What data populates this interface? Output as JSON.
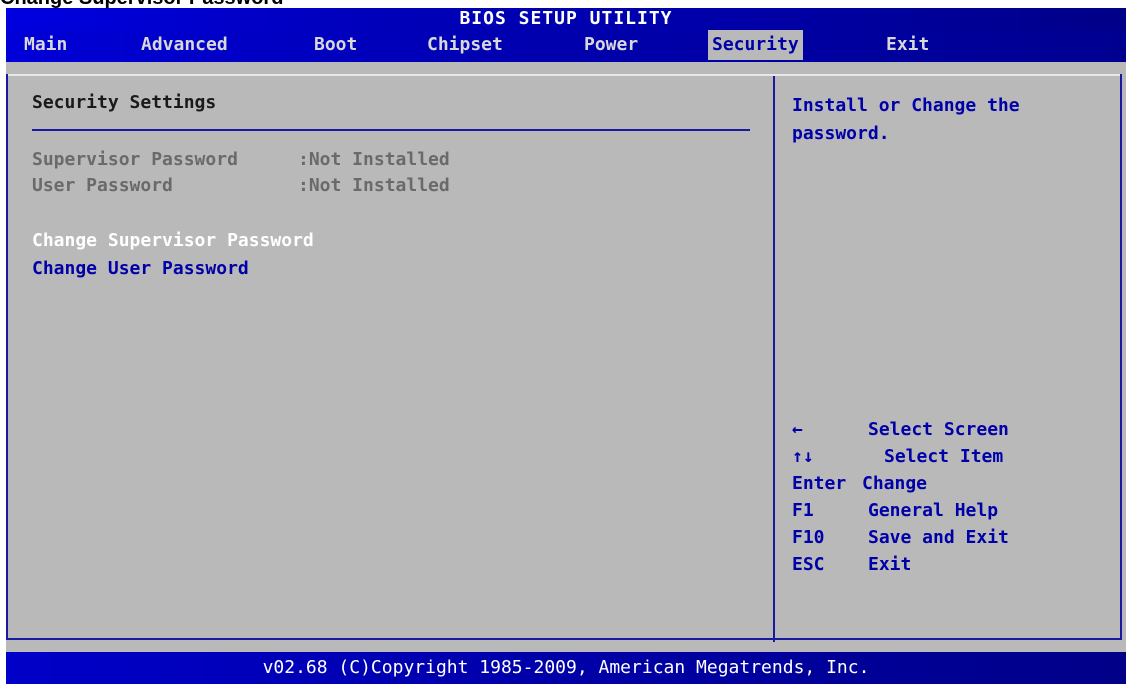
{
  "caption": "Change Supervisor Password",
  "title": "BIOS SETUP UTILITY",
  "menu": [
    {
      "label": "Main"
    },
    {
      "label": "Advanced"
    },
    {
      "label": "Boot"
    },
    {
      "label": "Chipset"
    },
    {
      "label": "Power"
    },
    {
      "label": "Security"
    },
    {
      "label": "Exit"
    }
  ],
  "active_menu": "Security",
  "section": {
    "title": "Security Settings"
  },
  "status": [
    {
      "label": "Supervisor Password",
      "value": ":Not Installed"
    },
    {
      "label": "User Password",
      "value": ":Not Installed"
    }
  ],
  "options": [
    {
      "label": "Change Supervisor Password",
      "selected": true
    },
    {
      "label": "Change User Password",
      "selected": false
    }
  ],
  "help_text": "Install or Change the password.",
  "keys": [
    {
      "key": "←",
      "desc": "Select Screen"
    },
    {
      "key": "↑↓",
      "desc": "Select Item"
    },
    {
      "key": "Enter",
      "desc": "Change"
    },
    {
      "key": "F1",
      "desc": "General Help"
    },
    {
      "key": "F10",
      "desc": "Save and Exit"
    },
    {
      "key": "ESC",
      "desc": "Exit"
    }
  ],
  "footer": "v02.68 (C)Copyright 1985-2009, American Megatrends, Inc.",
  "colors": {
    "background": "#b9b9b9",
    "bar_blue": "#0000a8",
    "highlight_text": "#ffffff",
    "option_text": "#0000a8",
    "muted_text": "#6a6a6a"
  }
}
